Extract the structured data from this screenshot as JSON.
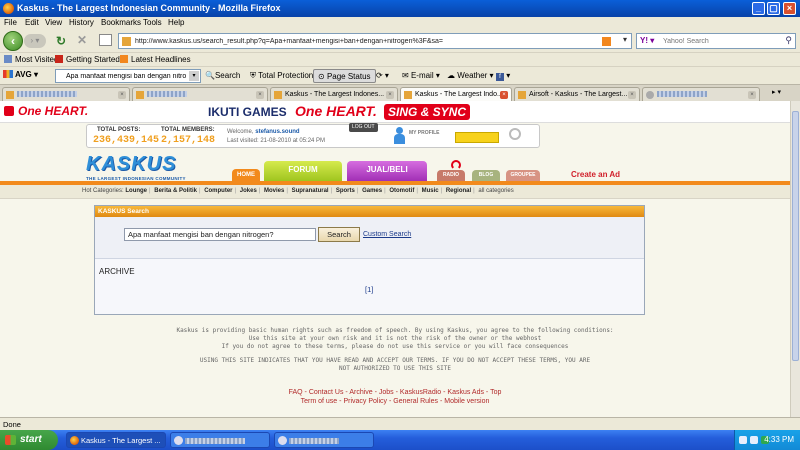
{
  "window": {
    "title": "Kaskus - The Largest Indonesian Community - Mozilla Firefox"
  },
  "menu": [
    "File",
    "Edit",
    "View",
    "History",
    "Bookmarks",
    "Tools",
    "Help"
  ],
  "nav": {
    "url": "http://www.kaskus.us/search_result.php?q=Apa+manfaat+mengisi+ban+dengan+nitrogen%3F&sa=",
    "search_placeholder": "Yahoo! Search"
  },
  "bookmarks": [
    "Most Visited",
    "Getting Started",
    "Latest Headlines"
  ],
  "avg_toolbar": {
    "brand": "AVG",
    "search_value": "Apa manfaat mengisi ban dengan nitrog",
    "search_button": "Search",
    "total_protection": "Total Protection",
    "page_status": "Page Status",
    "email": "E-mail",
    "weather": "Weather"
  },
  "tabs": [
    {
      "label": "",
      "redacted": true
    },
    {
      "label": "",
      "redacted": true
    },
    {
      "label": "Kaskus - The Largest Indones...",
      "redacted": false
    },
    {
      "label": "Kaskus - The Largest Indo...",
      "redacted": false,
      "active": true
    },
    {
      "label": "Airsoft - Kaskus - The Largest...",
      "redacted": false
    },
    {
      "label": "",
      "redacted": true
    }
  ],
  "ad": {
    "one_heart_1": "One HEART.",
    "ikuti_games": "IKUTI GAMES",
    "one_heart_2": "One HEART.",
    "sing_sync": "SING & SYNC"
  },
  "stats": {
    "total_posts_label": "TOTAL POSTS:",
    "total_posts": "236,439,145",
    "total_members_label": "TOTAL MEMBERS:",
    "total_members": "2,157,148",
    "welcome_prefix": "Welcome,",
    "username": "stefanus.sound",
    "last_visited": "Last visited: 21-08-2010 at 05:24 PM",
    "logout": "LOG OUT",
    "my_profile": "MY PROFILE"
  },
  "logo": {
    "name": "KASKUS",
    "tagline": "THE LARGEST INDONESIAN COMMUNITY"
  },
  "site_nav": {
    "home": "HOME",
    "forum": "FORUM",
    "jual_beli": "JUAL/BELI",
    "radio": "RADIO",
    "blog": "BLOG",
    "groupee": "GROUPEE",
    "create_ad": "Create an Ad"
  },
  "hot_categories": {
    "label": "Hot Categories:",
    "items": [
      "Lounge",
      "Berita & Politik",
      "Computer",
      "Jokes",
      "Movies",
      "Supranatural",
      "Sports",
      "Games",
      "Otomotif",
      "Music",
      "Regional"
    ],
    "all": "all categories"
  },
  "search_panel": {
    "header": "KASKUS Search",
    "query": "Apa manfaat mengisi ban dengan nitrogen?",
    "button": "Search",
    "custom_search": "Custom Search",
    "archive_label": "ARCHIVE",
    "page_indicator": "[1]"
  },
  "footer": {
    "terms_line1": "Kaskus is providing basic human rights such as freedom of speech. By using Kaskus, you agree to the following conditions:",
    "terms_line2": "Use this site at your own risk and it is not the risk of the owner or the webhost",
    "terms_line3": "If you do not agree to these terms, please do not use this service or you will face consequences",
    "terms_line4": "USING THIS SITE INDICATES THAT YOU HAVE READ AND ACCEPT OUR TERMS. IF YOU DO NOT ACCEPT THESE TERMS, YOU ARE",
    "terms_line5": "NOT AUTHORIZED TO USE THIS SITE",
    "links_row1": [
      "FAQ",
      "Contact Us",
      "Archive",
      "Jobs",
      "KaskusRadio",
      "Kaskus Ads",
      "Top"
    ],
    "links_row2": [
      "Term of use",
      "Privacy Policy",
      "General Rules",
      "Mobile version"
    ]
  },
  "statusbar": {
    "text": "Done"
  },
  "taskbar": {
    "start": "start",
    "windows": [
      {
        "label": "Kaskus - The Largest ...",
        "active": true
      },
      {
        "label": "",
        "redacted": true
      },
      {
        "label": "",
        "redacted": true
      }
    ],
    "clock": "4:33 PM"
  },
  "colors": {
    "accent_orange": "#f28a1c",
    "kaskus_blue": "#2f8fd8",
    "link_red": "#b12a2a",
    "ad_red": "#e10019"
  }
}
